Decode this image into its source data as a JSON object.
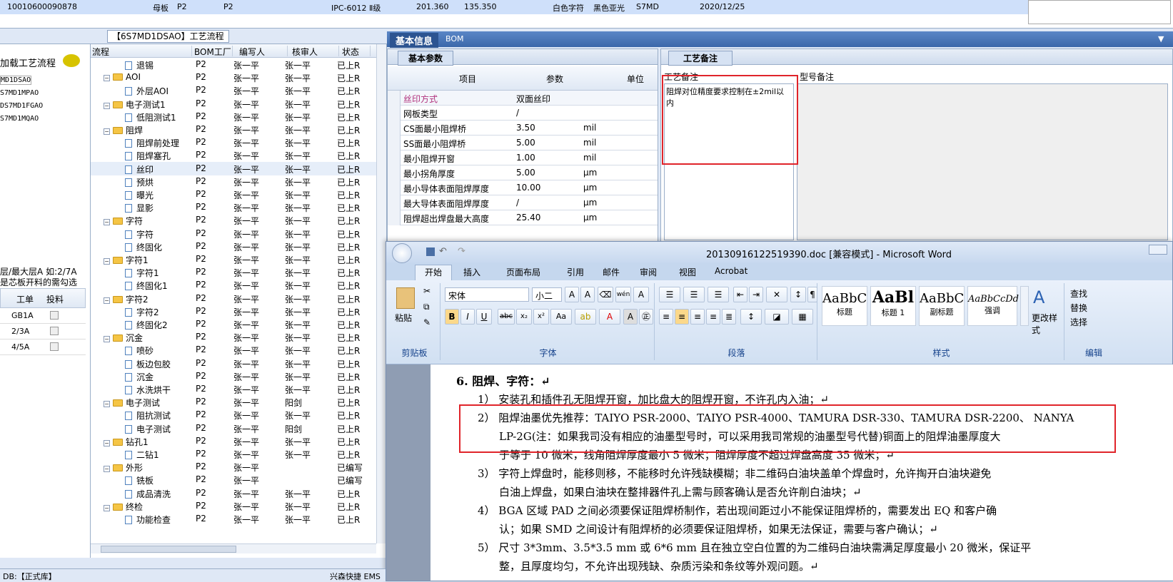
{
  "top_row": [
    "10010600090878",
    "母板",
    "P2",
    "P2",
    "IPC-6012 Ⅱ级",
    "201.360",
    "135.350",
    "白色字符",
    "黑色亚光",
    "S7MD",
    "2020/12/25"
  ],
  "left": {
    "load_flow_label": "加载工艺流程",
    "codes": [
      "MD1DSAO",
      "S7MD1MPAO",
      "DS7MD1FGAO",
      "S7MD1MQAO"
    ],
    "note_line1": "层/最大层A 如:2/7A",
    "note_line2": "是芯板开料的需勾选",
    "table_headers": [
      "工单",
      "投料"
    ],
    "table_rows": [
      "GB1A",
      "2/3A",
      "4/5A"
    ]
  },
  "tree": {
    "title": "【6S7MD1DSAO】工艺流程",
    "headers": [
      "流程",
      "BOM工厂",
      "编写人",
      "核审人",
      "状态"
    ],
    "rows": [
      {
        "name": "退锡",
        "type": "doc",
        "bom": "P2",
        "writer": "张一平",
        "reviewer": "张一平",
        "status": "已上R"
      },
      {
        "name": "AOI",
        "type": "folder",
        "bom": "P2",
        "writer": "张一平",
        "reviewer": "张一平",
        "status": "已上R"
      },
      {
        "name": "外层AOI",
        "type": "doc",
        "bom": "P2",
        "writer": "张一平",
        "reviewer": "张一平",
        "status": "已上R"
      },
      {
        "name": "电子测试1",
        "type": "folder",
        "bom": "P2",
        "writer": "张一平",
        "reviewer": "张一平",
        "status": "已上R"
      },
      {
        "name": "低阻测试1",
        "type": "doc",
        "bom": "P2",
        "writer": "张一平",
        "reviewer": "张一平",
        "status": "已上R"
      },
      {
        "name": "阻焊",
        "type": "folder",
        "bom": "P2",
        "writer": "张一平",
        "reviewer": "张一平",
        "status": "已上R"
      },
      {
        "name": "阻焊前处理",
        "type": "doc",
        "bom": "P2",
        "writer": "张一平",
        "reviewer": "张一平",
        "status": "已上R"
      },
      {
        "name": "阻焊塞孔",
        "type": "doc",
        "bom": "P2",
        "writer": "张一平",
        "reviewer": "张一平",
        "status": "已上R"
      },
      {
        "name": "丝印",
        "type": "doc",
        "bom": "P2",
        "writer": "张一平",
        "reviewer": "张一平",
        "status": "已上R"
      },
      {
        "name": "预烘",
        "type": "doc",
        "bom": "P2",
        "writer": "张一平",
        "reviewer": "张一平",
        "status": "已上R"
      },
      {
        "name": "曝光",
        "type": "doc",
        "bom": "P2",
        "writer": "张一平",
        "reviewer": "张一平",
        "status": "已上R"
      },
      {
        "name": "显影",
        "type": "doc",
        "bom": "P2",
        "writer": "张一平",
        "reviewer": "张一平",
        "status": "已上R"
      },
      {
        "name": "字符",
        "type": "folder",
        "bom": "P2",
        "writer": "张一平",
        "reviewer": "张一平",
        "status": "已上R"
      },
      {
        "name": "字符",
        "type": "doc",
        "bom": "P2",
        "writer": "张一平",
        "reviewer": "张一平",
        "status": "已上R"
      },
      {
        "name": "终固化",
        "type": "doc",
        "bom": "P2",
        "writer": "张一平",
        "reviewer": "张一平",
        "status": "已上R"
      },
      {
        "name": "字符1",
        "type": "folder",
        "bom": "P2",
        "writer": "张一平",
        "reviewer": "张一平",
        "status": "已上R"
      },
      {
        "name": "字符1",
        "type": "doc",
        "bom": "P2",
        "writer": "张一平",
        "reviewer": "张一平",
        "status": "已上R"
      },
      {
        "name": "终固化1",
        "type": "doc",
        "bom": "P2",
        "writer": "张一平",
        "reviewer": "张一平",
        "status": "已上R"
      },
      {
        "name": "字符2",
        "type": "folder",
        "bom": "P2",
        "writer": "张一平",
        "reviewer": "张一平",
        "status": "已上R"
      },
      {
        "name": "字符2",
        "type": "doc",
        "bom": "P2",
        "writer": "张一平",
        "reviewer": "张一平",
        "status": "已上R"
      },
      {
        "name": "终固化2",
        "type": "doc",
        "bom": "P2",
        "writer": "张一平",
        "reviewer": "张一平",
        "status": "已上R"
      },
      {
        "name": "沉金",
        "type": "folder",
        "bom": "P2",
        "writer": "张一平",
        "reviewer": "张一平",
        "status": "已上R"
      },
      {
        "name": "喷砂",
        "type": "doc",
        "bom": "P2",
        "writer": "张一平",
        "reviewer": "张一平",
        "status": "已上R"
      },
      {
        "name": "板边包胶",
        "type": "doc",
        "bom": "P2",
        "writer": "张一平",
        "reviewer": "张一平",
        "status": "已上R"
      },
      {
        "name": "沉金",
        "type": "doc",
        "bom": "P2",
        "writer": "张一平",
        "reviewer": "张一平",
        "status": "已上R"
      },
      {
        "name": "水洗烘干",
        "type": "doc",
        "bom": "P2",
        "writer": "张一平",
        "reviewer": "张一平",
        "status": "已上R"
      },
      {
        "name": "电子测试",
        "type": "folder",
        "bom": "P2",
        "writer": "张一平",
        "reviewer": "阳剑",
        "status": "已上R"
      },
      {
        "name": "阻抗测试",
        "type": "doc",
        "bom": "P2",
        "writer": "张一平",
        "reviewer": "张一平",
        "status": "已上R"
      },
      {
        "name": "电子测试",
        "type": "doc",
        "bom": "P2",
        "writer": "张一平",
        "reviewer": "阳剑",
        "status": "已上R"
      },
      {
        "name": "钻孔1",
        "type": "folder",
        "bom": "P2",
        "writer": "张一平",
        "reviewer": "张一平",
        "status": "已上R"
      },
      {
        "name": "二钻1",
        "type": "doc",
        "bom": "P2",
        "writer": "张一平",
        "reviewer": "张一平",
        "status": "已上R"
      },
      {
        "name": "外形",
        "type": "folder",
        "bom": "P2",
        "writer": "张一平",
        "reviewer": "",
        "status": "已编写"
      },
      {
        "name": "铣板",
        "type": "doc",
        "bom": "P2",
        "writer": "张一平",
        "reviewer": "",
        "status": "已编写"
      },
      {
        "name": "成品清洗",
        "type": "doc",
        "bom": "P2",
        "writer": "张一平",
        "reviewer": "张一平",
        "status": "已上R"
      },
      {
        "name": "终检",
        "type": "folder",
        "bom": "P2",
        "writer": "张一平",
        "reviewer": "张一平",
        "status": "已上R"
      },
      {
        "name": "功能检查",
        "type": "doc",
        "bom": "P2",
        "writer": "张一平",
        "reviewer": "张一平",
        "status": "已上R"
      }
    ]
  },
  "basic": {
    "tab_basic": "基本信息",
    "tab_bom": "BOM",
    "params_tab": "基本参数",
    "headers": [
      "项目",
      "参数",
      "单位"
    ],
    "rows": [
      {
        "item": "丝印方式",
        "value": "双面丝印",
        "unit": ""
      },
      {
        "item": "网板类型",
        "value": "/",
        "unit": ""
      },
      {
        "item": "CS面最小阻焊桥",
        "value": "3.50",
        "unit": "mil"
      },
      {
        "item": "SS面最小阻焊桥",
        "value": "5.00",
        "unit": "mil"
      },
      {
        "item": "最小阻焊开窗",
        "value": "1.00",
        "unit": "mil"
      },
      {
        "item": "最小拐角厚度",
        "value": "5.00",
        "unit": "μm"
      },
      {
        "item": "最小导体表面阻焊厚度",
        "value": "10.00",
        "unit": "μm"
      },
      {
        "item": "最大导体表面阻焊厚度",
        "value": "/",
        "unit": "μm"
      },
      {
        "item": "阻焊超出焊盘最大高度",
        "value": "25.40",
        "unit": "μm"
      }
    ],
    "notes_tab": "工艺备注",
    "process_note_label": "工艺备注",
    "model_note_label": "型号备注",
    "process_note_text": "阻焊对位精度要求控制在±2mil以内"
  },
  "word": {
    "title": "20130916122519390.doc [兼容模式] - Microsoft Word",
    "tabs": [
      "开始",
      "插入",
      "页面布局",
      "引用",
      "邮件",
      "审阅",
      "视图",
      "Acrobat"
    ],
    "clipboard": {
      "paste": "粘贴",
      "label": "剪贴板"
    },
    "font": {
      "name": "宋体",
      "size": "小二",
      "label": "字体"
    },
    "paragraph_label": "段落",
    "styles": [
      {
        "preview": "AaBbC",
        "name": "标题"
      },
      {
        "preview": "AaBl",
        "name": "标题 1"
      },
      {
        "preview": "AaBbC",
        "name": "副标题"
      },
      {
        "preview": "AaBbCcDd",
        "name": "强调"
      }
    ],
    "styles_label": "样式",
    "change_style": "更改样式",
    "editing": {
      "find": "查找",
      "replace": "替换",
      "select": "选择",
      "label": "编辑"
    },
    "doc_lines": [
      "6.  阻焊、字符：↵",
      "1） 安装孔和插件孔无阻焊开窗，加比盘大的阻焊开窗，不许孔内入油；↵",
      "2） 阻焊油墨优先推荐：TAIYO PSR-2000、TAIYO PSR-4000、TAMURA  DSR-330、TAMURA DSR-2200、 NANYA",
      "LP-2G(注：如果我司没有相应的油墨型号时，可以采用我司常规的油墨型号代替)铜面上的阻焊油墨厚度大",
      "于等于 10 微米，线角阻焊厚度最小 5 微米；阻焊厚度不超过焊盘高度 35 微米；↵",
      "3） 字符上焊盘时，能移则移，不能移时允许残缺模糊；非二维码白油块盖单个焊盘时，允许掏开白油块避免",
      "白油上焊盘，如果白油块在整排器件孔上需与顾客确认是否允许削白油块；↵",
      "4） BGA 区域 PAD 之间必须要保证阻焊桥制作，若出现间距过小不能保证阻焊桥的，需要发出 EQ 和客户确",
      "认；如果 SMD 之间设计有阻焊桥的必须要保证阻焊桥，如果无法保证，需要与客户确认；↵",
      "5） 尺寸 3*3mm、3.5*3.5 mm 或 6*6 mm 且在独立空白位置的为二维码白油块需满足厚度最小 20 微米，保证平",
      "整，且厚度均匀，不允许出现残缺、杂质污染和条纹等外观问题。↵"
    ]
  },
  "status": {
    "db": "DB:【正式库】",
    "company": "兴森快捷 EMS"
  },
  "colors": {
    "red_box": "#e0242a",
    "header_blue": "#3c68aa",
    "ribbon": "#d1e0f2"
  }
}
